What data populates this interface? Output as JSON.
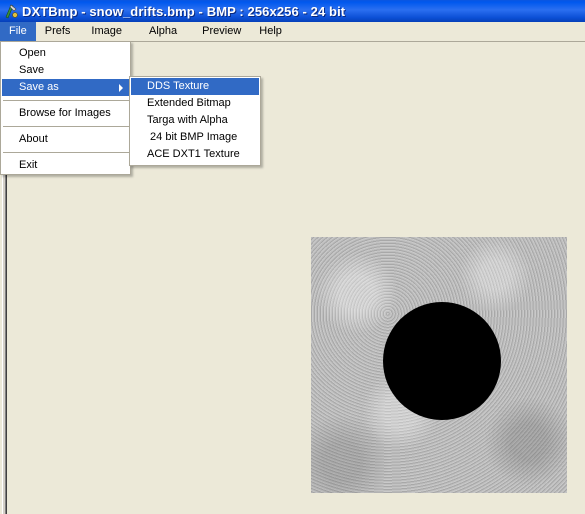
{
  "window": {
    "title": "DXTBmp - snow_drifts.bmp - BMP : 256x256 - 24 bit",
    "icon": "dxtbmp-app-icon"
  },
  "menubar": {
    "items": [
      "File",
      "Prefs",
      "Image",
      "Alpha",
      "Preview",
      "Help"
    ],
    "active": "File"
  },
  "file_menu": {
    "items": [
      "Open",
      "Save",
      "Save as",
      "Browse for Images",
      "About",
      "Exit"
    ],
    "highlighted": "Save as"
  },
  "save_as_submenu": {
    "items": [
      "DDS Texture",
      "Extended Bitmap",
      "Targa with Alpha",
      " 24 bit BMP Image",
      "ACE DXT1 Texture"
    ],
    "highlighted": "DDS Texture"
  },
  "canvas": {
    "image": "snow-texture-with-black-circle",
    "colors": {
      "highlight": "#316ac5",
      "title_blue": "#0058ee",
      "background": "#ece9d8"
    }
  }
}
